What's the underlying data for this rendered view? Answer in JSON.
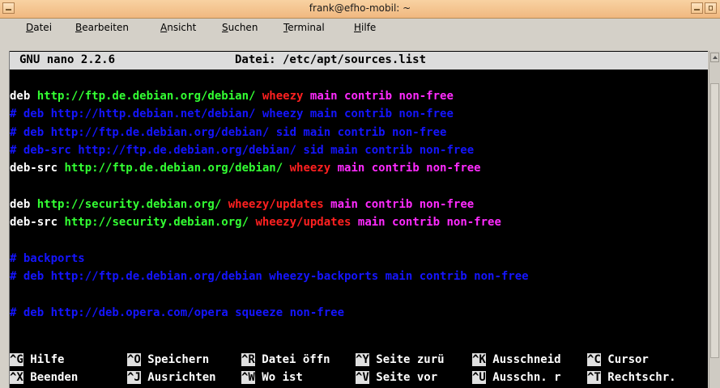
{
  "window": {
    "title": "frank@efho-mobil: ~",
    "accent_color": "#f0b880"
  },
  "menubar": {
    "items": [
      {
        "pre": "",
        "u": "D",
        "post": "atei"
      },
      {
        "pre": "",
        "u": "B",
        "post": "earbeiten"
      },
      {
        "pre": "",
        "u": "A",
        "post": "nsicht"
      },
      {
        "pre": "",
        "u": "S",
        "post": "uchen"
      },
      {
        "pre": "",
        "u": "T",
        "post": "erminal"
      },
      {
        "pre": "",
        "u": "H",
        "post": "ilfe"
      }
    ]
  },
  "nano": {
    "version": "GNU nano 2.2.6",
    "file_label": "Datei: /etc/apt/sources.list"
  },
  "lines": [
    [
      {
        "t": "deb ",
        "c": "white"
      },
      {
        "t": "http://ftp.de.debian.org/debian/ ",
        "c": "green"
      },
      {
        "t": "wheezy ",
        "c": "red"
      },
      {
        "t": "main contrib non-free",
        "c": "magenta"
      }
    ],
    [
      {
        "t": "# deb http://http.debian.net/debian/ wheezy main contrib non-free",
        "c": "blue"
      }
    ],
    [
      {
        "t": "# deb http://ftp.de.debian.org/debian/ sid main contrib non-free",
        "c": "blue"
      }
    ],
    [
      {
        "t": "# deb-src http://ftp.de.debian.org/debian/ sid main contrib non-free",
        "c": "blue"
      }
    ],
    [
      {
        "t": "deb-src ",
        "c": "white"
      },
      {
        "t": "http://ftp.de.debian.org/debian/ ",
        "c": "green"
      },
      {
        "t": "wheezy ",
        "c": "red"
      },
      {
        "t": "main contrib non-free",
        "c": "magenta"
      }
    ],
    [],
    [
      {
        "t": "deb ",
        "c": "white"
      },
      {
        "t": "http://security.debian.org/ ",
        "c": "green"
      },
      {
        "t": "wheezy/updates ",
        "c": "red"
      },
      {
        "t": "main contrib non-free",
        "c": "magenta"
      }
    ],
    [
      {
        "t": "deb-src ",
        "c": "white"
      },
      {
        "t": "http://security.debian.org/ ",
        "c": "green"
      },
      {
        "t": "wheezy/updates ",
        "c": "red"
      },
      {
        "t": "main contrib non-free",
        "c": "magenta"
      }
    ],
    [],
    [
      {
        "t": "# backports",
        "c": "blue"
      }
    ],
    [
      {
        "t": "# deb http://ftp.de.debian.org/debian wheezy-backports main contrib non-free",
        "c": "blue"
      }
    ],
    [],
    [
      {
        "t": "# deb http://deb.opera.com/opera squeeze non-free",
        "c": "blue"
      }
    ]
  ],
  "shortcuts": {
    "row1": [
      {
        "key": "^G",
        "label": " Hilfe     "
      },
      {
        "key": "^O",
        "label": " Speichern "
      },
      {
        "key": "^R",
        "label": " Datei öffn"
      },
      {
        "key": "^Y",
        "label": " Seite zurü"
      },
      {
        "key": "^K",
        "label": " Ausschneid"
      },
      {
        "key": "^C",
        "label": " Cursor"
      }
    ],
    "row2": [
      {
        "key": "^X",
        "label": " Beenden   "
      },
      {
        "key": "^J",
        "label": " Ausrichten"
      },
      {
        "key": "^W",
        "label": " Wo ist    "
      },
      {
        "key": "^V",
        "label": " Seite vor "
      },
      {
        "key": "^U",
        "label": " Ausschn. r"
      },
      {
        "key": "^T",
        "label": " Rechtschr."
      }
    ]
  }
}
